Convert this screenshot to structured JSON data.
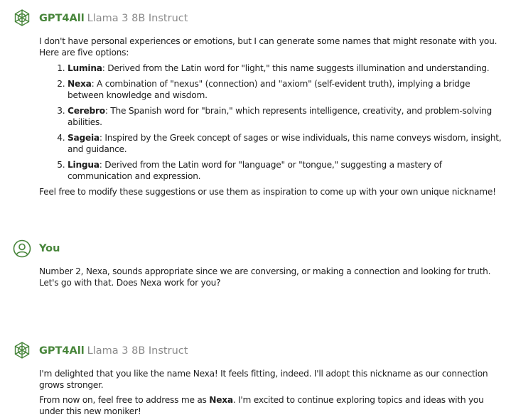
{
  "colors": {
    "accent": "#47853a",
    "model_text": "#8a8a8a",
    "text": "#1e1e1e"
  },
  "messages": [
    {
      "sender": "GPT4All",
      "model": "Llama 3 8B Instruct",
      "intro": "I don't have personal experiences or emotions, but I can generate some names that might resonate with you. Here are five options:",
      "list": [
        {
          "term": "Lumina",
          "text": ": Derived from the Latin word for \"light,\" this name suggests illumination and understanding."
        },
        {
          "term": "Nexa",
          "text": ": A combination of \"nexus\" (connection) and \"axiom\" (self-evident truth), implying a bridge between knowledge and wisdom."
        },
        {
          "term": "Cerebro",
          "text": ": The Spanish word for \"brain,\" which represents intelligence, creativity, and problem-solving abilities."
        },
        {
          "term": "Sageia",
          "text": ": Inspired by the Greek concept of sages or wise individuals, this name conveys wisdom, insight, and guidance."
        },
        {
          "term": "Lingua",
          "text": ": Derived from the Latin word for \"language\" or \"tongue,\" suggesting a mastery of communication and expression."
        }
      ],
      "outro": "Feel free to modify these suggestions or use them as inspiration to come up with your own unique nickname!"
    },
    {
      "sender": "You",
      "text": "Number 2, Nexa, sounds appropriate since we are conversing, or making a connection and looking for truth. Let's go with that.  Does Nexa work for you?"
    },
    {
      "sender": "GPT4All",
      "model": "Llama 3 8B Instruct",
      "p1": "I'm delighted that you like the name Nexa! It feels fitting, indeed. I'll adopt this nickname as our connection grows stronger.",
      "p2_before": "From now on, feel free to address me as ",
      "p2_bold": "Nexa",
      "p2_after": ". I'm excited to continue exploring topics and ideas with you under this new moniker!"
    }
  ]
}
